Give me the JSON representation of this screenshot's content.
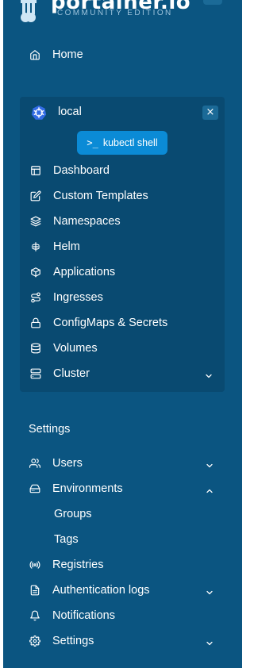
{
  "brand": {
    "name": "portainer.io",
    "edition": "COMMUNITY EDITION"
  },
  "home": {
    "label": "Home",
    "icon": "home-icon"
  },
  "environment": {
    "name": "local",
    "icon": "kubernetes-icon",
    "close_label": "×",
    "kubectl_button": {
      "prompt": ">_",
      "label": "kubectl shell"
    },
    "items": [
      {
        "label": "Dashboard",
        "icon": "dashboard-icon"
      },
      {
        "label": "Custom Templates",
        "icon": "edit-icon"
      },
      {
        "label": "Namespaces",
        "icon": "layers-icon"
      },
      {
        "label": "Helm",
        "icon": "helm-icon"
      },
      {
        "label": "Applications",
        "icon": "box-icon"
      },
      {
        "label": "Ingresses",
        "icon": "route-icon"
      },
      {
        "label": "ConfigMaps & Secrets",
        "icon": "lock-icon"
      },
      {
        "label": "Volumes",
        "icon": "database-icon"
      },
      {
        "label": "Cluster",
        "icon": "server-icon",
        "expandable": true,
        "expanded": false
      }
    ]
  },
  "settings_section": {
    "title": "Settings",
    "items": [
      {
        "label": "Users",
        "icon": "users-icon",
        "expandable": true,
        "expanded": false
      },
      {
        "label": "Environments",
        "icon": "hard-drive-icon",
        "expandable": true,
        "expanded": true,
        "children": [
          {
            "label": "Groups"
          },
          {
            "label": "Tags"
          }
        ]
      },
      {
        "label": "Registries",
        "icon": "radio-icon"
      },
      {
        "label": "Authentication logs",
        "icon": "file-text-icon",
        "expandable": true,
        "expanded": false
      },
      {
        "label": "Notifications",
        "icon": "bell-icon"
      },
      {
        "label": "Settings",
        "icon": "gear-icon",
        "expandable": true,
        "expanded": false
      }
    ]
  },
  "colors": {
    "sidebar_bg": "#0b5581",
    "env_box_bg": "#094a71",
    "accent_button": "#0b8bd6",
    "text": "#ffffff"
  }
}
